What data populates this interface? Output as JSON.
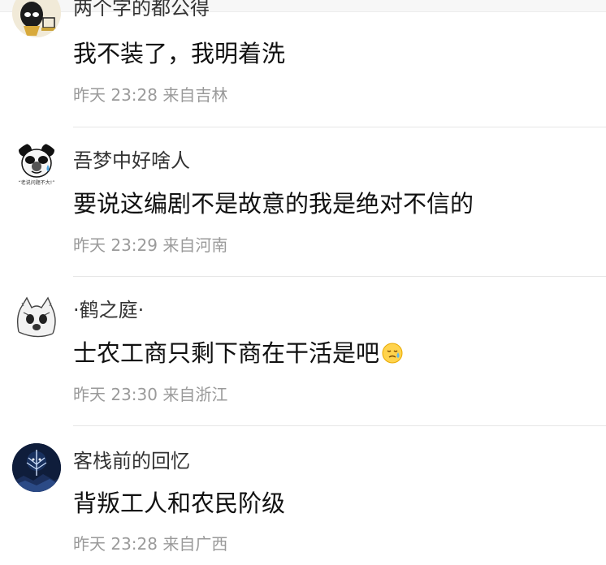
{
  "comments": [
    {
      "user": "两个字的都公得",
      "text": "我不装了，我明着洗",
      "time": "昨天 23:28",
      "location": "来自吉林"
    },
    {
      "user": "吾梦中好啥人",
      "text": "要说这编剧不是故意的我是绝对不信的",
      "time": "昨天 23:29",
      "location": "来自河南",
      "avatar_caption": "“老说问题不大!”"
    },
    {
      "user": "·鹤之庭·",
      "text": "士农工商只剩下商在干活是吧",
      "emoji": "crying-face-emoji",
      "time": "昨天 23:30",
      "location": "来自浙江"
    },
    {
      "user": "客栈前的回忆",
      "text": "背叛工人和农民阶级",
      "time": "昨天 23:28",
      "location": "来自广西"
    }
  ],
  "colors": {
    "username": "#333333",
    "text": "#111111",
    "meta": "#9a9a9a",
    "divider": "#e6e6e6"
  }
}
